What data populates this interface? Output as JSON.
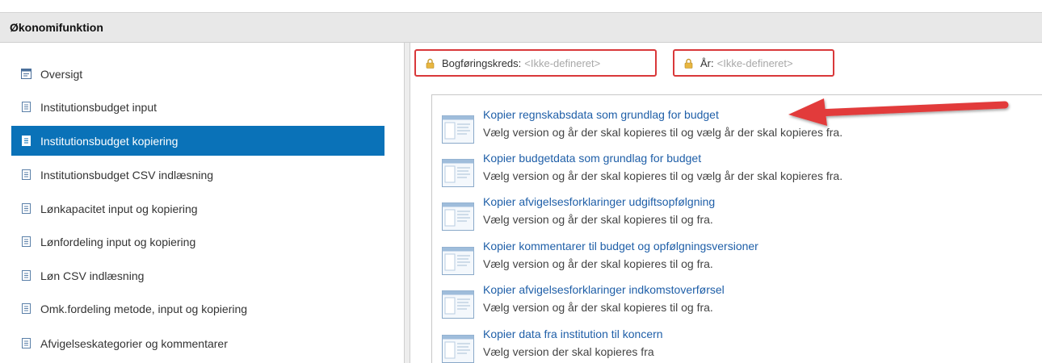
{
  "header": {
    "title": "Økonomifunktion"
  },
  "sidebar": {
    "items": [
      {
        "label": "Oversigt",
        "icon": "overview-icon",
        "selected": false
      },
      {
        "label": "Institutionsbudget input",
        "icon": "document-icon",
        "selected": false
      },
      {
        "label": "Institutionsbudget kopiering",
        "icon": "document-icon",
        "selected": true
      },
      {
        "label": "Institutionsbudget CSV indlæsning",
        "icon": "document-icon",
        "selected": false
      },
      {
        "label": "Lønkapacitet input og kopiering",
        "icon": "document-icon",
        "selected": false
      },
      {
        "label": "Lønfordeling input og kopiering",
        "icon": "document-icon",
        "selected": false
      },
      {
        "label": "Løn CSV indlæsning",
        "icon": "document-icon",
        "selected": false
      },
      {
        "label": "Omk.fordeling metode, input og kopiering",
        "icon": "document-icon",
        "selected": false
      },
      {
        "label": "Afvigelseskategorier og kommentarer",
        "icon": "document-icon",
        "selected": false
      }
    ]
  },
  "filters": {
    "bogforingskreds": {
      "label": "Bogføringskreds:",
      "value": "<Ikke-defineret>",
      "icon": "lock-icon"
    },
    "ar": {
      "label": "År:",
      "value": "<Ikke-defineret>",
      "icon": "lock-icon"
    }
  },
  "tasks": {
    "items": [
      {
        "title": "Kopier regnskabsdata som grundlag for budget",
        "description": "Vælg version og år der skal kopieres til og vælg år der skal kopieres fra."
      },
      {
        "title": "Kopier budgetdata som grundlag for budget",
        "description": "Vælg version og år der skal kopieres til og vælg år der skal kopieres fra."
      },
      {
        "title": "Kopier afvigelsesforklaringer udgiftsopfølgning",
        "description": "Vælg version og år der skal kopieres til og fra."
      },
      {
        "title": "Kopier kommentarer til budget og opfølgningsversioner",
        "description": "Vælg version og år der skal kopieres til og fra."
      },
      {
        "title": "Kopier afvigelsesforklaringer indkomstoverførsel",
        "description": "Vælg version og år der skal kopieres til og fra."
      },
      {
        "title": "Kopier data fra institution til koncern",
        "description": "Vælg version der skal kopieres fra"
      }
    ]
  },
  "annotation": {
    "icon": "red-arrow-icon",
    "color": "#e23b3b"
  },
  "colors": {
    "accent": "#0a72b8",
    "link": "#1f5fa8",
    "alert_border": "#d9383a"
  }
}
